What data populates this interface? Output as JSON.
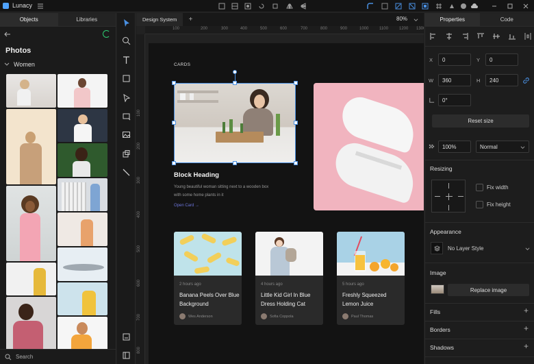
{
  "app": {
    "name": "Lunacy"
  },
  "left_panel": {
    "tabs": [
      "Objects",
      "Libraries"
    ],
    "title": "Photos",
    "category": "Women",
    "search_placeholder": "Search"
  },
  "canvas": {
    "doc_tab": "Design System",
    "add_tab": "+",
    "zoom": "80%",
    "ruler_h": [
      "100",
      "200",
      "300",
      "400",
      "500",
      "600",
      "700",
      "800",
      "900",
      "1000",
      "1100",
      "1200",
      "1300"
    ],
    "ruler_v": [
      "100",
      "200",
      "300",
      "400",
      "500",
      "600",
      "700",
      "800"
    ],
    "section_label": "CARDS",
    "feature": {
      "heading": "Block Heading",
      "body": "Young beautiful woman sitting next to a wooden box with some home plants in it",
      "link": "Open Card →"
    },
    "cards": [
      {
        "time": "2 hours ago",
        "title": "Banana Peels Over Blue Background",
        "author": "Wes Anderson"
      },
      {
        "time": "4 hours ago",
        "title": "Little Kid Girl In Blue Dress Holding Cat",
        "author": "Sofia Coppola"
      },
      {
        "time": "5 hours ago",
        "title": "Freshly Squeezed Lemon Juice",
        "author": "Paul Thomas"
      }
    ]
  },
  "right_panel": {
    "tabs": [
      "Properties",
      "Code"
    ],
    "x_label": "X",
    "x_value": "0",
    "y_label": "Y",
    "y_value": "0",
    "w_label": "W",
    "w_value": "360",
    "h_label": "H",
    "h_value": "240",
    "rotation_value": "0°",
    "reset_size": "Reset size",
    "opacity": "100%",
    "blend": "Normal",
    "resizing_title": "Resizing",
    "fix_width": "Fix width",
    "fix_height": "Fix height",
    "appearance_title": "Appearance",
    "layer_style": "No Layer Style",
    "image_title": "Image",
    "replace_image": "Replace image",
    "fills": "Fills",
    "borders": "Borders",
    "shadows": "Shadows",
    "plus": "+"
  },
  "colors": {
    "accent": "#4a90e2",
    "pink": "#f2b6c1",
    "card_bg": "#2a2a2a"
  }
}
